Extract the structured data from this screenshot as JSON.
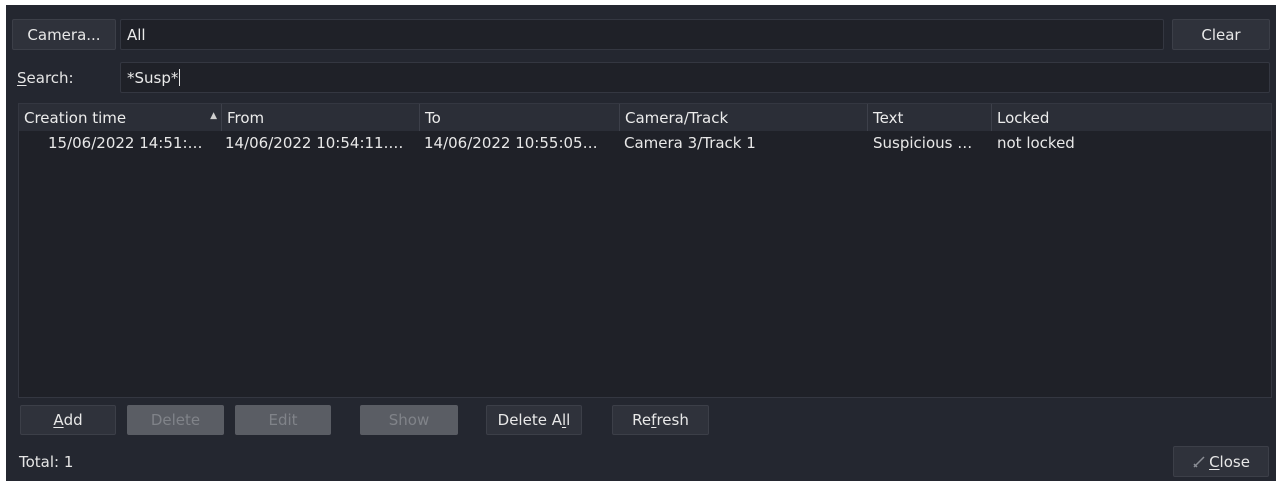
{
  "toolbar": {
    "camera_button": "Camera...",
    "camera_value": "All",
    "clear_button": "Clear"
  },
  "search": {
    "label": "Search:",
    "value": "*Susp*"
  },
  "table": {
    "columns": [
      "Creation time",
      "From",
      "To",
      "Camera/Track",
      "Text",
      "Locked"
    ],
    "rows": [
      {
        "creation_time": "15/06/2022 14:51:…",
        "from": "14/06/2022 10:54:11.…",
        "to": "14/06/2022 10:55:05…",
        "camera_track": "Camera 3/Track 1",
        "text": "Suspicious …",
        "locked": "not locked"
      }
    ]
  },
  "actions": {
    "add": "Add",
    "delete": "Delete",
    "edit": "Edit",
    "show": "Show",
    "delete_all": "Delete All",
    "refresh": "Refresh"
  },
  "footer": {
    "total_label": "Total:",
    "total_value": "1",
    "close_button": "Close"
  }
}
